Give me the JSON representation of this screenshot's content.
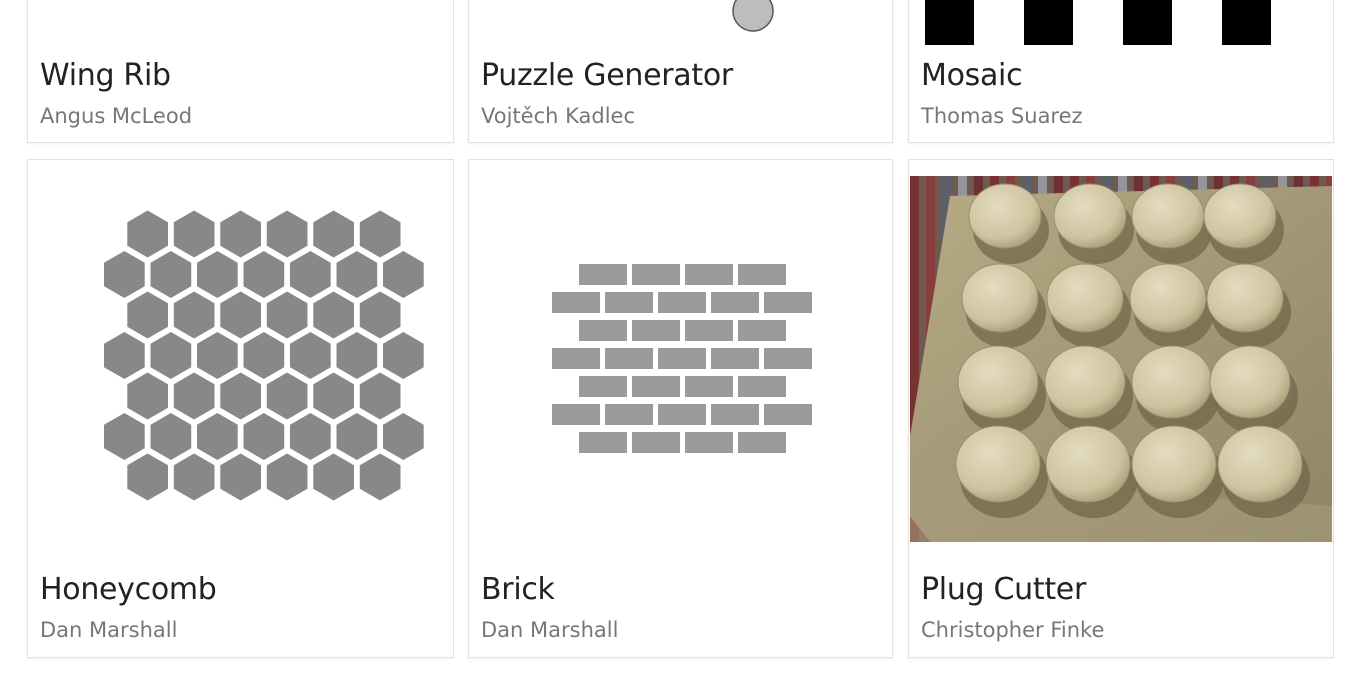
{
  "projects": [
    {
      "title": "Wing Rib",
      "author": "Angus McLeod",
      "thumbnail": "wing-rib-drawing"
    },
    {
      "title": "Puzzle Generator",
      "author": "Vojtěch Kadlec",
      "thumbnail": "puzzle-drawing"
    },
    {
      "title": "Mosaic",
      "author": "Thomas Suarez",
      "thumbnail": "mosaic-pattern"
    },
    {
      "title": "Honeycomb",
      "author": "Dan Marshall",
      "thumbnail": "hexagon-pattern",
      "fill_color": "#888888"
    },
    {
      "title": "Brick",
      "author": "Dan Marshall",
      "thumbnail": "brick-pattern",
      "fill_color": "#9a9a9a"
    },
    {
      "title": "Plug Cutter",
      "author": "Christopher Finke",
      "thumbnail": "wooden-plugs-photo"
    }
  ]
}
